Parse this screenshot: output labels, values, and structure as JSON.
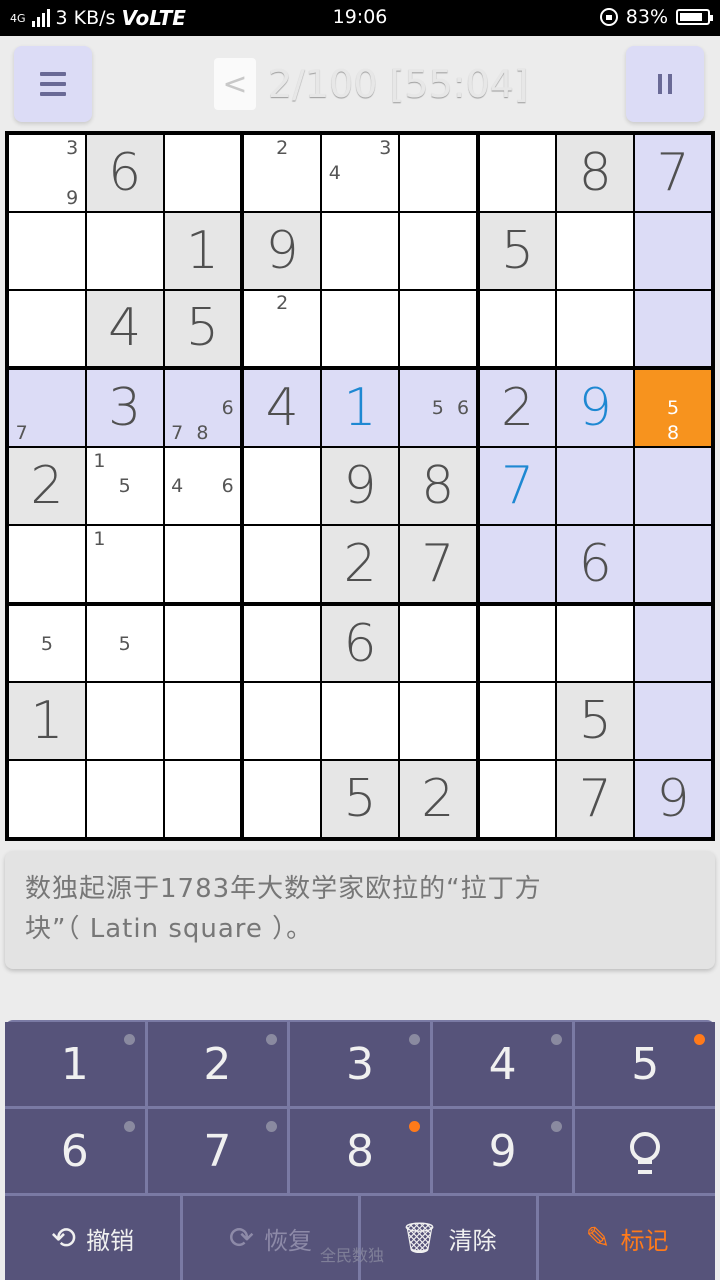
{
  "status_bar": {
    "network": "4G",
    "speed": "3 KB/s",
    "volte": "VoLTE",
    "time": "19:06",
    "battery": "83%"
  },
  "header": {
    "back_label": "<",
    "progress": "2/100 [55:04]"
  },
  "board": {
    "rows": [
      [
        {
          "notes": [
            "3",
            "9"
          ],
          "style": "w"
        },
        {
          "value": "6",
          "style": "g"
        },
        {
          "style": "w"
        },
        {
          "notes": [
            "2"
          ],
          "style": "w"
        },
        {
          "notes": [
            "4",
            "3"
          ],
          "style": "w"
        },
        {
          "style": "w"
        },
        {
          "style": "w"
        },
        {
          "value": "8",
          "style": "g"
        },
        {
          "value": "7",
          "style": "h"
        }
      ],
      [
        {
          "style": "w"
        },
        {
          "style": "w"
        },
        {
          "value": "1",
          "style": "g"
        },
        {
          "value": "9",
          "style": "g"
        },
        {
          "style": "w"
        },
        {
          "style": "w"
        },
        {
          "value": "5",
          "style": "g"
        },
        {
          "style": "w"
        },
        {
          "style": "h"
        }
      ],
      [
        {
          "style": "w"
        },
        {
          "value": "4",
          "style": "g"
        },
        {
          "value": "5",
          "style": "g"
        },
        {
          "notes": [
            "2"
          ],
          "style": "w"
        },
        {
          "style": "w"
        },
        {
          "style": "w"
        },
        {
          "style": "w"
        },
        {
          "style": "w"
        },
        {
          "style": "h"
        }
      ],
      [
        {
          "notes": [
            "7"
          ],
          "style": "h"
        },
        {
          "value": "3",
          "style": "h"
        },
        {
          "notes": [
            "6",
            "7",
            "8"
          ],
          "style": "h"
        },
        {
          "value": "4",
          "style": "h"
        },
        {
          "value": "1",
          "style": "h",
          "blue": true
        },
        {
          "notes": [
            "5",
            "6"
          ],
          "style": "h"
        },
        {
          "value": "2",
          "style": "h"
        },
        {
          "value": "9",
          "style": "h",
          "blue": true
        },
        {
          "notes": [
            "5",
            "8"
          ],
          "style": "sel"
        }
      ],
      [
        {
          "value": "2",
          "style": "g"
        },
        {
          "notes": [
            "1",
            "5"
          ],
          "style": "w"
        },
        {
          "notes": [
            "4",
            "6"
          ],
          "style": "w"
        },
        {
          "style": "w"
        },
        {
          "value": "9",
          "style": "g"
        },
        {
          "value": "8",
          "style": "g"
        },
        {
          "value": "7",
          "style": "h",
          "blue": true
        },
        {
          "style": "h"
        },
        {
          "style": "h"
        }
      ],
      [
        {
          "style": "w"
        },
        {
          "notes": [
            "1"
          ],
          "style": "w"
        },
        {
          "style": "w"
        },
        {
          "style": "w"
        },
        {
          "value": "2",
          "style": "g"
        },
        {
          "value": "7",
          "style": "g"
        },
        {
          "style": "h"
        },
        {
          "value": "6",
          "style": "h"
        },
        {
          "style": "h"
        }
      ],
      [
        {
          "notes": [
            "5"
          ],
          "style": "w"
        },
        {
          "notes": [
            "5"
          ],
          "style": "w"
        },
        {
          "style": "w"
        },
        {
          "style": "w"
        },
        {
          "value": "6",
          "style": "g"
        },
        {
          "style": "w"
        },
        {
          "style": "w"
        },
        {
          "style": "w"
        },
        {
          "style": "h"
        }
      ],
      [
        {
          "value": "1",
          "style": "g"
        },
        {
          "style": "w"
        },
        {
          "style": "w"
        },
        {
          "style": "w"
        },
        {
          "style": "w"
        },
        {
          "style": "w"
        },
        {
          "style": "w"
        },
        {
          "value": "5",
          "style": "g"
        },
        {
          "style": "h"
        }
      ],
      [
        {
          "style": "w"
        },
        {
          "style": "w"
        },
        {
          "style": "w"
        },
        {
          "style": "w"
        },
        {
          "value": "5",
          "style": "g"
        },
        {
          "value": "2",
          "style": "g"
        },
        {
          "style": "w"
        },
        {
          "value": "7",
          "style": "g"
        },
        {
          "value": "9",
          "style": "h"
        }
      ]
    ]
  },
  "tip": {
    "line1": "数独起源于1783年大数学家欧拉的“拉丁方",
    "line2": "块”（ Latin square ）。"
  },
  "keypad": {
    "keys": [
      {
        "label": "1",
        "dot": "grey"
      },
      {
        "label": "2",
        "dot": "grey"
      },
      {
        "label": "3",
        "dot": "grey"
      },
      {
        "label": "4",
        "dot": "grey"
      },
      {
        "label": "5",
        "dot": "orange"
      },
      {
        "label": "6",
        "dot": "grey"
      },
      {
        "label": "7",
        "dot": "grey"
      },
      {
        "label": "8",
        "dot": "orange"
      },
      {
        "label": "9",
        "dot": "grey"
      }
    ],
    "hint_icon": "lightbulb-icon",
    "actions": {
      "undo": "撤销",
      "redo": "恢复",
      "clear": "清除",
      "mark": "标记"
    },
    "watermark": "全民数独"
  },
  "colors": {
    "accent": "#f7931e",
    "highlight": "#dcdcf6",
    "given_cell": "#e6e6e6",
    "user_digit": "#1e88d2",
    "keypad_bg": "#56537a",
    "dot_active": "#ff7a1a"
  }
}
